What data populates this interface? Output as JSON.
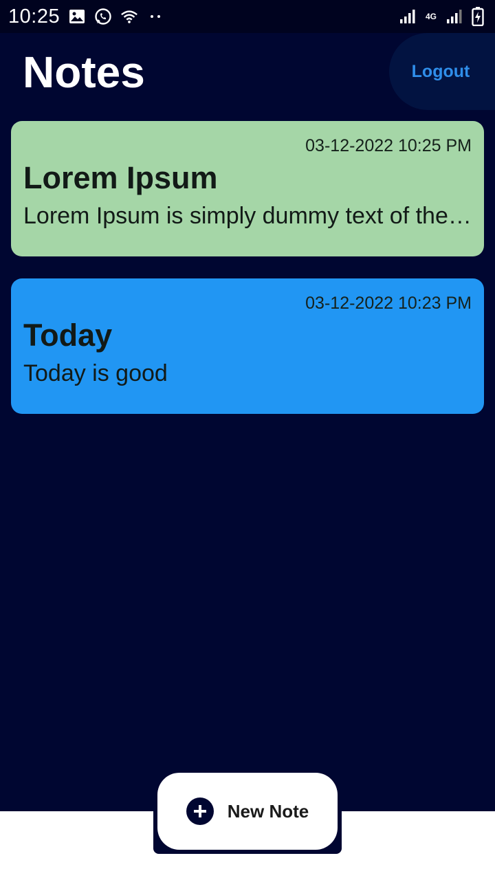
{
  "status_bar": {
    "time": "10:25",
    "left_icons": [
      "image-icon",
      "whatsapp-icon",
      "wifi-icon",
      "more-dots-icon"
    ],
    "network_label": "4G",
    "right_icons": [
      "signal-icon",
      "network-4g-icon",
      "signal-icon",
      "battery-charging-icon"
    ]
  },
  "header": {
    "title": "Notes",
    "logout_label": "Logout"
  },
  "notes": [
    {
      "date": "03-12-2022 10:25 PM",
      "title": "Lorem Ipsum",
      "body": "Lorem Ipsum is simply dummy text of the printing and typesetting industry.",
      "color": "#a5d6a7"
    },
    {
      "date": "03-12-2022 10:23 PM",
      "title": "Today",
      "body": "Today is good",
      "color": "#2196f3"
    }
  ],
  "fab": {
    "label": "New Note",
    "icon": "plus-circle-icon"
  },
  "colors": {
    "background": "#000631",
    "status_bar": "#00031f",
    "logout_text": "#2f8eea",
    "logout_bg": "#021341"
  }
}
